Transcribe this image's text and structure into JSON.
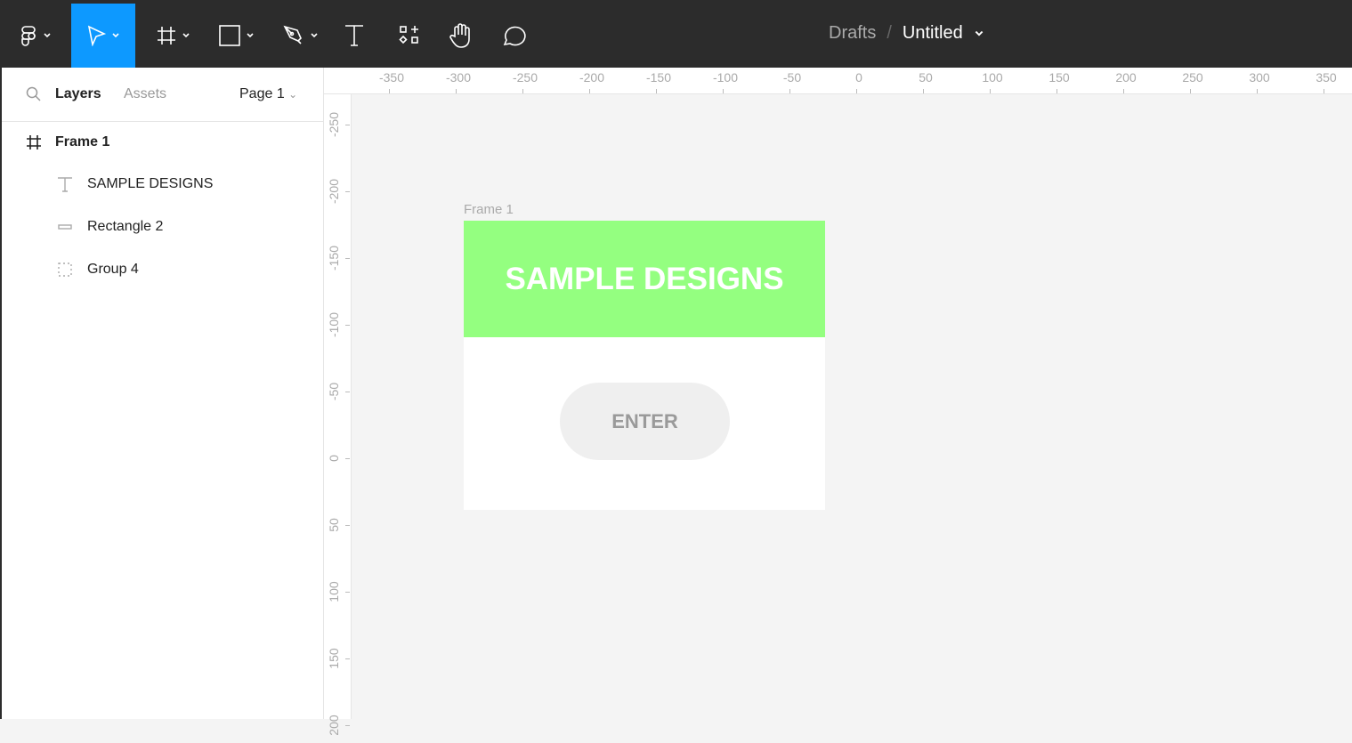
{
  "toolbar": {
    "tools": [
      "main-menu",
      "move",
      "frame",
      "rectangle",
      "pen",
      "text",
      "resources",
      "hand",
      "comment"
    ],
    "active": "move",
    "accent": "#0d99ff"
  },
  "breadcrumb": {
    "folder": "Drafts",
    "separator": "/",
    "file": "Untitled"
  },
  "sidebar": {
    "tabs": {
      "layers": "Layers",
      "assets": "Assets"
    },
    "page": "Page 1",
    "layers": [
      {
        "name": "Frame 1",
        "type": "frame"
      },
      {
        "name": "SAMPLE DESIGNS",
        "type": "text"
      },
      {
        "name": "Rectangle 2",
        "type": "rectangle"
      },
      {
        "name": "Group 4",
        "type": "group"
      }
    ]
  },
  "ruler": {
    "h": [
      "-350",
      "-300",
      "-250",
      "-200",
      "-150",
      "-100",
      "-50",
      "0",
      "50",
      "100",
      "150",
      "200",
      "250",
      "300",
      "350"
    ],
    "v": [
      "-250",
      "-200",
      "-150",
      "-100",
      "-50",
      "0",
      "50",
      "100",
      "150",
      "200"
    ]
  },
  "canvas": {
    "frame_label": "Frame 1",
    "title": "SAMPLE DESIGNS",
    "button": "ENTER",
    "header_color": "#94ff80"
  }
}
